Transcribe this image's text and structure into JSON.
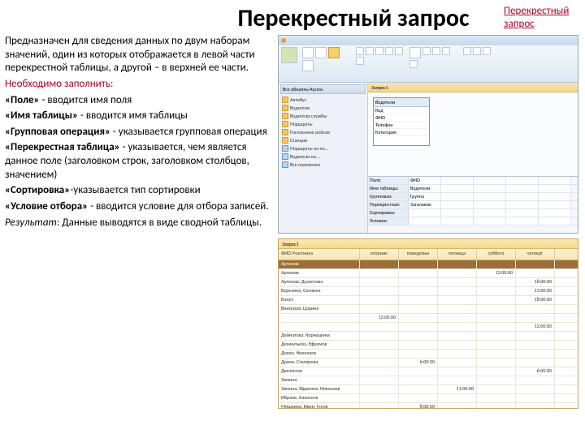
{
  "title": "Перекрестный запрос",
  "corner_label": "Перекрестный запрос",
  "left": {
    "intro": "Предназначен для сведения данных по двум наборам значений, один из которых отображается в левой части перекрестной таблицы, а другой – в верхней ее части.",
    "must_fill": "Необходимо заполнить:",
    "field_b": "«Поле»",
    "field_t": " - вводится имя поля",
    "tblname_b": "«Имя таблицы»",
    "tblname_t": " - вводится имя таблицы",
    "grpop_b": "«Групповая операция»",
    "grpop_t": " - указывается групповая операция",
    "cross_b": "«Перекрестная таблица»",
    "cross_t": " - указывается, чем является данное поле (заголовком строк, заголовком столбцов, значением)",
    "sort_b": "«Сортировка»",
    "sort_t": "-указывается тип сортировки",
    "cond_b": "«Условие отбора»",
    "cond_t": " - вводится условие для отбора записей.",
    "result_label": "Результат",
    "result_text": ": Данные выводятся в виде сводной таблицы."
  },
  "ss1": {
    "nav_header": "Все объекты Access",
    "nav_items": [
      "Автобус",
      "Водители",
      "Водители службы",
      "Маршруты",
      "Расписание рейсов",
      "Станции"
    ],
    "nav_queries": [
      "Маршруты на пл...",
      "Водители по...",
      "Все перевозки"
    ],
    "tab": "Запрос1",
    "float_hdr": "Водители",
    "float_rows": [
      "Код",
      "ФИО",
      "Телефон",
      "Категория"
    ],
    "grid_labels": [
      "Поле:",
      "Имя таблицы:",
      "Групповая:",
      "Перекрестная:",
      "Сортировка:",
      "Условие:"
    ],
    "grid_vals": [
      "ФИО",
      "Водители",
      "Группа",
      "Заголовок"
    ]
  },
  "ss2": {
    "tab": "Запрос1",
    "columns": [
      "ФИО Участника",
      "вторник",
      "понедельн",
      "пятница",
      "суббота",
      "четверг"
    ],
    "rows": [
      {
        "n": "Артюхов",
        "cells": [
          "",
          "",
          "",
          "12:00:00",
          ""
        ]
      },
      {
        "n": "Артюхов, Досветова",
        "cells": [
          "",
          "",
          "",
          "",
          "18:00:00"
        ]
      },
      {
        "n": "Березина, Соснина",
        "cells": [
          "",
          "",
          "",
          "",
          "13:00:00"
        ]
      },
      {
        "n": "Бонуэ",
        "cells": [
          "",
          "",
          "",
          "",
          "18:00:00"
        ]
      },
      {
        "n": "Виногров, Царина",
        "cells": [
          "",
          "",
          "",
          "",
          ""
        ]
      },
      {
        "n": "",
        "cells": [
          "12:00:00",
          "",
          "",
          "",
          ""
        ]
      },
      {
        "n": "",
        "cells": [
          "",
          "",
          "",
          "",
          "12:00:00"
        ]
      },
      {
        "n": "Дейнатова, Корношина",
        "cells": [
          "",
          "",
          "",
          "",
          ""
        ]
      },
      {
        "n": "Дементьева, Ефремов",
        "cells": [
          "",
          "",
          "",
          "",
          ""
        ]
      },
      {
        "n": "Доева, Николаев",
        "cells": [
          "",
          "",
          "",
          "",
          ""
        ]
      },
      {
        "n": "Дроев, Столярова",
        "cells": [
          "",
          "6:00:00",
          "",
          "",
          ""
        ]
      },
      {
        "n": "Дюсметов",
        "cells": [
          "",
          "",
          "",
          "",
          "6:00:00"
        ]
      },
      {
        "n": "Зимина",
        "cells": [
          "",
          "",
          "",
          "",
          ""
        ]
      },
      {
        "n": "Зимина, Ефремов, Николаев",
        "cells": [
          "",
          "",
          "11:00:00",
          "",
          ""
        ]
      },
      {
        "n": "Ибраев, Алексеев",
        "cells": [
          "",
          "",
          "",
          "",
          ""
        ]
      },
      {
        "n": "Мишкина, Ивин, Гулов",
        "cells": [
          "",
          "8:00:00",
          "",
          "",
          ""
        ]
      }
    ],
    "selected_label": "Артюхов"
  }
}
